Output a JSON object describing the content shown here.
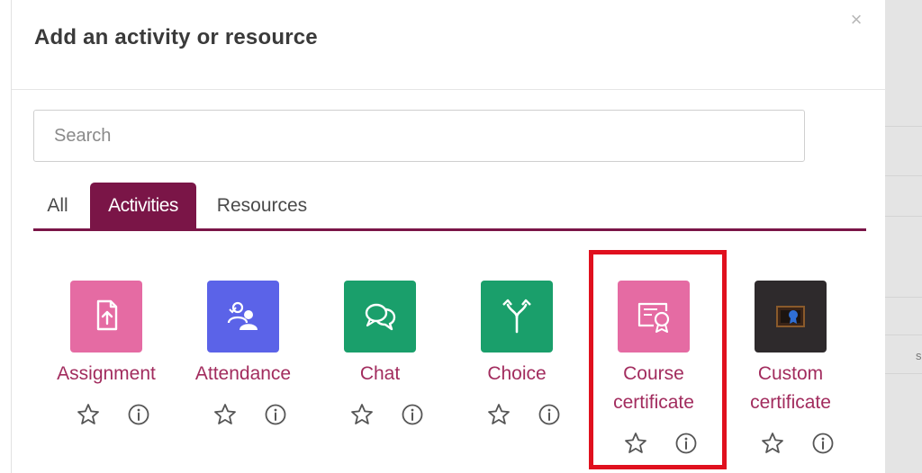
{
  "modal": {
    "title": "Add an activity or resource",
    "close_symbol": "×"
  },
  "search": {
    "placeholder": "Search",
    "value": ""
  },
  "tabs": [
    {
      "label": "All",
      "active": false
    },
    {
      "label": "Activities",
      "active": true
    },
    {
      "label": "Resources",
      "active": false
    }
  ],
  "activities": [
    {
      "name_lines": [
        "Assignment"
      ],
      "color": "#e56ba3",
      "icon": "assignment-icon"
    },
    {
      "name_lines": [
        "Attendance"
      ],
      "color": "#5b63e8",
      "icon": "attendance-icon"
    },
    {
      "name_lines": [
        "Chat"
      ],
      "color": "#1a9f6b",
      "icon": "chat-icon"
    },
    {
      "name_lines": [
        "Choice"
      ],
      "color": "#1a9f6b",
      "icon": "choice-icon"
    },
    {
      "name_lines": [
        "Course",
        "certificate"
      ],
      "color": "#e56ba3",
      "icon": "course-certificate-icon"
    },
    {
      "name_lines": [
        "Custom",
        "certificate"
      ],
      "color": "#2e2a2c",
      "icon": "custom-certificate-icon"
    }
  ],
  "colors": {
    "accent": "#7a1547",
    "link": "#a22c5e",
    "highlight": "#e0101e"
  },
  "background_fragments": [
    "s"
  ]
}
